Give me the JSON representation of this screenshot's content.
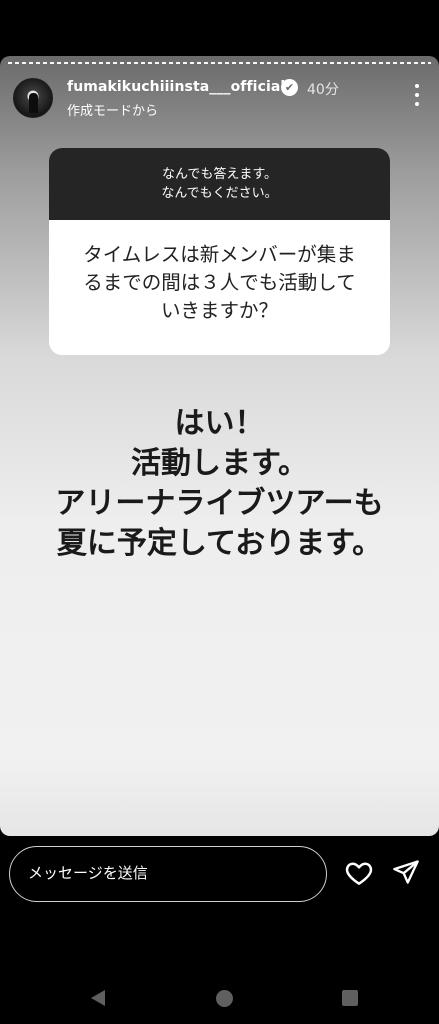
{
  "story": {
    "username": "fumakikuchiiinsta___official",
    "verified_mark": "✔",
    "time_ago": "40分",
    "subtitle": "作成モードから",
    "question_header_line1": "なんでも答えます。",
    "question_header_line2": "なんでもください。",
    "question_line1": "タイムレスは新メンバーが集ま",
    "question_line2": "るまでの間は３人でも活動して",
    "question_line3": "いきますか？",
    "answer_line1": "はい！",
    "answer_line2": "活動します。",
    "answer_line3": "アリーナライブツアーも",
    "answer_line4": "夏に予定しております。"
  },
  "reply": {
    "message_placeholder": "メッセージを送信"
  },
  "icons": {
    "avatar": "profile-avatar",
    "verified": "verified-badge-icon",
    "more": "more-vertical-icon",
    "like": "heart-icon",
    "send": "send-icon",
    "nav_back": "nav-back-icon",
    "nav_home": "nav-home-icon",
    "nav_recent": "nav-recent-icon"
  },
  "colors": {
    "background": "#000000",
    "question_header": "#252525",
    "answer_text": "#1a1a1a"
  }
}
